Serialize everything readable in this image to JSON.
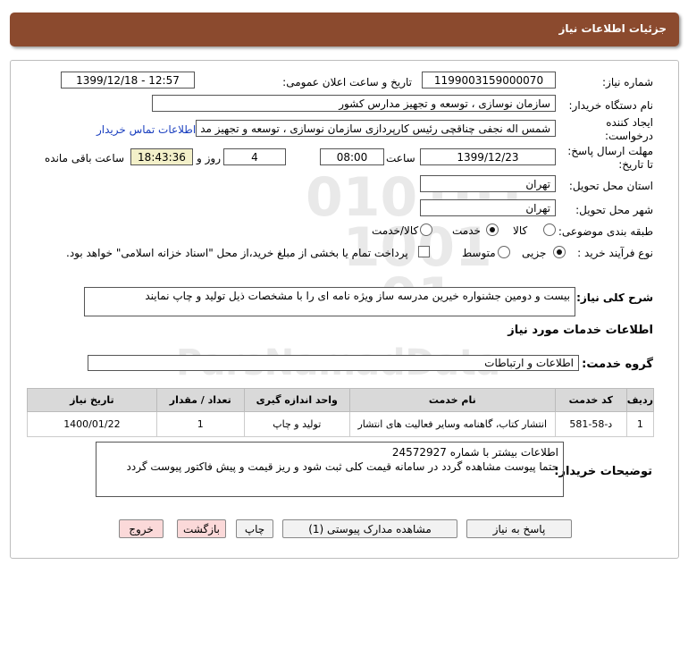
{
  "header": {
    "title": "جزئیات اطلاعات نیاز"
  },
  "fields": {
    "need_number_label": "شماره نیاز:",
    "need_number": "1199003159000070",
    "announce_label": "تاریخ و ساعت اعلان عمومی:",
    "announce_value": "1399/12/18 - 12:57",
    "buyer_org_label": "نام دستگاه خریدار:",
    "buyer_org": "سازمان نوسازی ، توسعه و تجهیز مدارس کشور",
    "creator_label_line1": "ایجاد کننده",
    "creator_label_line2": "درخواست:",
    "creator": "شمس اله نجفی چناقچی رئیس کارپردازی سازمان نوسازی ، توسعه و تجهیز مد",
    "contact_link": "اطلاعات تماس خریدار",
    "deadline_label_line1": "مهلت ارسال پاسخ:",
    "deadline_label_line2": "تا تاریخ:",
    "deadline_date": "1399/12/23",
    "time_label": "ساعت",
    "deadline_time": "08:00",
    "days": "4",
    "days_label": "روز و",
    "remaining": "18:43:36",
    "remaining_label": "ساعت باقی مانده",
    "province_label": "استان محل تحویل:",
    "province": "تهران",
    "city_label": "شهر محل تحویل:",
    "city": "تهران",
    "category_label": "طبقه بندی موضوعی:",
    "category_options": [
      "کالا",
      "خدمت",
      "کالا/خدمت"
    ],
    "category_selected": "خدمت",
    "process_label": "نوع فرآیند خرید :",
    "process_options": [
      "جزیی",
      "متوسط"
    ],
    "process_selected": "جزیی",
    "payment_note": "پرداخت تمام یا بخشی از مبلغ خرید،از محل \"اسناد خزانه اسلامی\" خواهد بود."
  },
  "summary": {
    "label": "شرح کلی نیاز:",
    "text": "بیست و دومین جشنواره خیرین مدرسه ساز ویژه نامه ای را با مشخصات ذیل تولید و چاپ نمایند"
  },
  "services": {
    "section_title": "اطلاعات خدمات مورد نیاز",
    "group_label": "گروه خدمت:",
    "group_value": "اطلاعات و ارتباطات",
    "columns": [
      "ردیف",
      "کد خدمت",
      "نام خدمت",
      "واحد اندازه گیری",
      "تعداد / مقدار",
      "تاریخ نیاز"
    ],
    "rows": [
      {
        "index": "1",
        "code": "د-58-581",
        "name": "انتشار کتاب، گاهنامه وسایر فعالیت های انتشار",
        "unit": "تولید و چاپ",
        "qty": "1",
        "date": "1400/01/22"
      }
    ]
  },
  "buyer_notes": {
    "label": "توضیحات خریدار:",
    "line1": "اطلاعات بیشتر با شماره 24572927",
    "line2": "حتما پیوست مشاهده گردد در سامانه قیمت کلی ثبت شود و ریز قیمت و پیش فاکتور پیوست گردد"
  },
  "buttons": {
    "reply": "پاسخ به نیاز",
    "attachments": "مشاهده مدارک پیوستی (1)",
    "print": "چاپ",
    "back": "بازگشت",
    "exit": "خروج"
  },
  "colors": {
    "header": "#8b4a2e",
    "remaining_bg": "#f3f0c9",
    "link": "#1a3fbf"
  }
}
